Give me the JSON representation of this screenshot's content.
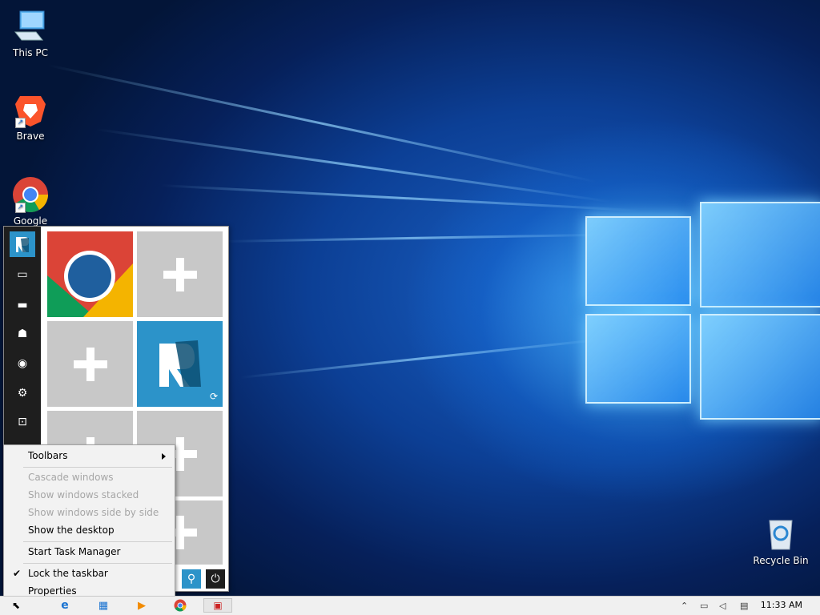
{
  "desktop": {
    "icons": [
      {
        "label": "This PC"
      },
      {
        "label": "Brave"
      },
      {
        "label": "Google"
      },
      {
        "label": "Recycle Bin"
      }
    ]
  },
  "start_menu": {
    "rail": [
      {
        "icon": "app-logo-icon"
      },
      {
        "icon": "monitor-icon"
      },
      {
        "icon": "folder-icon"
      },
      {
        "icon": "users-icon"
      },
      {
        "icon": "network-icon"
      },
      {
        "icon": "settings-icon"
      },
      {
        "icon": "performance-icon"
      }
    ],
    "tiles": [
      {
        "type": "app",
        "icon": "chrome-icon"
      },
      {
        "type": "add",
        "icon": "plus-icon"
      },
      {
        "type": "add",
        "icon": "plus-icon"
      },
      {
        "type": "app",
        "icon": "app-logo-icon"
      },
      {
        "type": "add",
        "icon": "plus-icon"
      },
      {
        "type": "add",
        "icon": "plus-icon"
      },
      {
        "type": "add",
        "icon": "plus-icon"
      }
    ]
  },
  "context_menu": {
    "items": [
      {
        "label": "Toolbars",
        "enabled": true,
        "submenu": true
      },
      {
        "label": "Cascade windows",
        "enabled": false
      },
      {
        "label": "Show windows stacked",
        "enabled": false
      },
      {
        "label": "Show windows side by side",
        "enabled": false
      },
      {
        "label": "Show the desktop",
        "enabled": true
      },
      {
        "label": "Start Task Manager",
        "enabled": true
      },
      {
        "label": "Lock the taskbar",
        "enabled": true,
        "checked": true
      },
      {
        "label": "Properties",
        "enabled": true
      }
    ]
  },
  "taskbar": {
    "clock": "11:33 AM",
    "pinned": [
      "edge-icon",
      "store-icon",
      "media-player-icon",
      "chrome-icon",
      "app-window-icon"
    ]
  },
  "colors": {
    "rail_bg": "#1e1e1e",
    "accent": "#2c93c9",
    "tile_gray": "#c8c8c8"
  }
}
